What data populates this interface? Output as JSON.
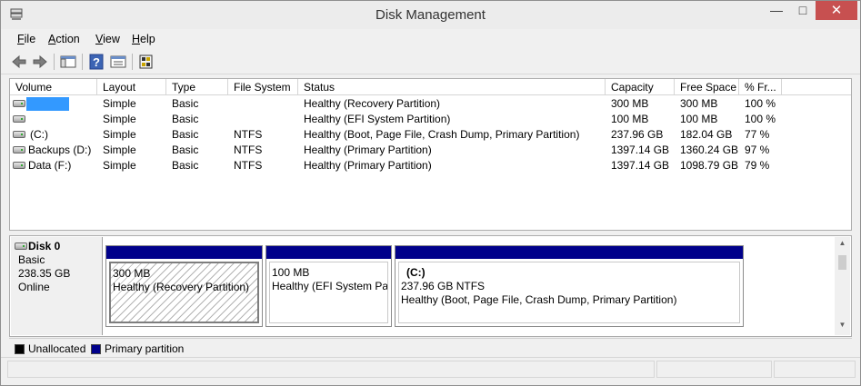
{
  "window": {
    "title": "Disk Management",
    "close_glyph": "✕",
    "min_glyph": "—",
    "max_glyph": "□"
  },
  "menu": [
    "File",
    "Action",
    "View",
    "Help"
  ],
  "menu_hotkeys": [
    "F",
    "A",
    "V",
    "H"
  ],
  "toolbar": [
    "back-icon",
    "forward-icon",
    "console-tree-icon",
    "help-icon",
    "properties-icon",
    "export-list-icon"
  ],
  "columns": [
    "Volume",
    "Layout",
    "Type",
    "File System",
    "Status",
    "Capacity",
    "Free Space",
    "% Fr..."
  ],
  "volumes": [
    {
      "volume": "",
      "layout": "Simple",
      "type": "Basic",
      "fs": "",
      "status": "Healthy (Recovery Partition)",
      "capacity": "300 MB",
      "free": "300 MB",
      "pct": "100 %"
    },
    {
      "volume": "",
      "layout": "Simple",
      "type": "Basic",
      "fs": "",
      "status": "Healthy (EFI System Partition)",
      "capacity": "100 MB",
      "free": "100 MB",
      "pct": "100 %"
    },
    {
      "volume": "(C:)",
      "layout": "Simple",
      "type": "Basic",
      "fs": "NTFS",
      "status": "Healthy (Boot, Page File, Crash Dump, Primary Partition)",
      "capacity": "237.96 GB",
      "free": "182.04 GB",
      "pct": "77 %"
    },
    {
      "volume": "Backups (D:)",
      "layout": "Simple",
      "type": "Basic",
      "fs": "NTFS",
      "status": "Healthy (Primary Partition)",
      "capacity": "1397.14 GB",
      "free": "1360.24 GB",
      "pct": "97 %"
    },
    {
      "volume": "Data (F:)",
      "layout": "Simple",
      "type": "Basic",
      "fs": "NTFS",
      "status": "Healthy (Primary Partition)",
      "capacity": "1397.14 GB",
      "free": "1098.79 GB",
      "pct": "79 %"
    }
  ],
  "disk": {
    "name": "Disk 0",
    "type": "Basic",
    "size": "238.35 GB",
    "state": "Online",
    "partitions": [
      {
        "label": "",
        "size": "300 MB",
        "status": "Healthy (Recovery Partition)"
      },
      {
        "label": "",
        "size": "100 MB",
        "status": "Healthy (EFI System Partition)"
      },
      {
        "label": "(C:)",
        "size": "237.96 GB NTFS",
        "status": "Healthy (Boot, Page File, Crash Dump, Primary Partition)"
      }
    ]
  },
  "legend": [
    {
      "label": "Unallocated",
      "color": "#000000"
    },
    {
      "label": "Primary partition",
      "color": "#00008b"
    }
  ],
  "colors": {
    "partition_bar": "#00008b",
    "selection": "#3399ff",
    "close_button": "#c75050"
  }
}
